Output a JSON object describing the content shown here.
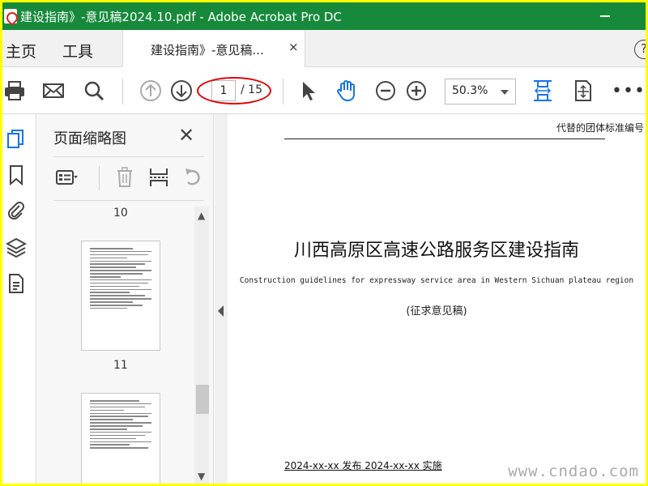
{
  "window": {
    "title": "建设指南》-意见稿2024.10.pdf - Adobe Acrobat Pro DC"
  },
  "tabs": {
    "home": "主页",
    "tools": "工具",
    "document": "建设指南》-意见稿...",
    "close": "×",
    "help": "?"
  },
  "toolbar": {
    "page_current": "1",
    "page_total": "/ 15",
    "zoom": "50.3%",
    "more": "•••"
  },
  "thumbnails_panel": {
    "title": "页面缩略图",
    "close": "✕",
    "page_labels": [
      "10",
      "11"
    ]
  },
  "document": {
    "standard_code": "代替的团体标准编号",
    "title_cn": "川西高原区高速公路服务区建设指南",
    "title_en": "Construction guidelines for expressway service area in Western Sichuan plateau region",
    "draft_label": "(征求意见稿)",
    "dates": "2024-xx-xx 发布 2024-xx-xx 实施"
  },
  "watermark": "www.cndao.com",
  "colors": {
    "titlebar": "#168a3a",
    "frame_border": "#ffff00",
    "accent_blue": "#1473e6",
    "annotation_red": "#e00000"
  }
}
